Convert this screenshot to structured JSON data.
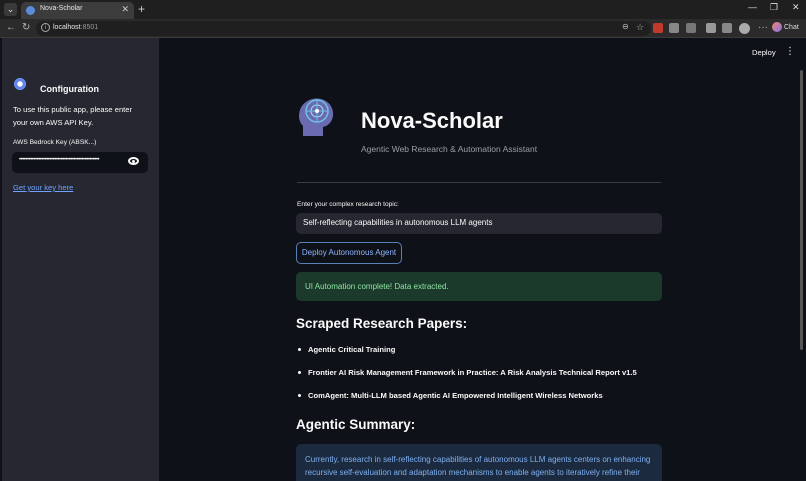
{
  "browser": {
    "tab_title": "Nova-Scholar",
    "tab_close": "✕",
    "new_tab": "+",
    "url_host": "localhost",
    "url_port": ":8501",
    "chat_label": "Chat"
  },
  "sidebar": {
    "heading": "Configuration",
    "intro": "To use this public app, please enter your own AWS API Key.",
    "key_label": "AWS Bedrock Key (ABSK...)",
    "key_value": "••••••••••••••••••••••••••••••••••••••••••••••••••",
    "key_link": "Get your key here"
  },
  "header": {
    "deploy_label": "Deploy",
    "menu_glyph": "⋮"
  },
  "main": {
    "title": "Nova-Scholar",
    "subtitle": "Agentic Web Research & Automation Assistant",
    "topic_label": "Enter your complex research topic:",
    "topic_value": "Self-reflecting capabilities in autonomous LLM agents",
    "deploy_button": "Deploy Autonomous Agent",
    "success_message": "UI Automation complete! Data extracted.",
    "papers_heading": "Scraped Research Papers:",
    "papers": [
      "Agentic Critical Training",
      "Frontier AI Risk Management Framework in Practice: A Risk Analysis Technical Report v1.5",
      "ComAgent: Multi-LLM based Agentic AI Empowered Intelligent Wireless Networks"
    ],
    "summary_heading": "Agentic Summary:",
    "summary_text": "Currently, research in self-reflecting capabilities of autonomous LLM agents centers on enhancing recursive self-evaluation and adaptation mechanisms to enable agents to iteratively refine their"
  },
  "icons": {
    "tab_menu": "chevron-down-icon",
    "back": "back-arrow-icon",
    "forward": "forward-arrow-icon",
    "reload": "reload-icon",
    "sidebar_gear": "gear-icon",
    "password_toggle": "eye-icon",
    "logo": "brain-circuit-icon"
  },
  "colors": {
    "background": "#0e1117",
    "sidebar": "#262730",
    "accent_link": "#6ea4ff",
    "success_bg": "#1c3a2b",
    "success_text": "#8be3a1",
    "info_bg": "#1b2a3f",
    "info_text": "#7fb0f0"
  }
}
